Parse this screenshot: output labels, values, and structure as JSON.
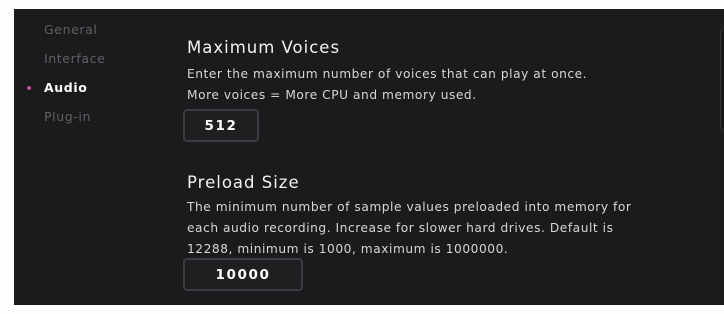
{
  "sidebar": {
    "items": [
      {
        "label": "General",
        "active": false
      },
      {
        "label": "Interface",
        "active": false
      },
      {
        "label": "Audio",
        "active": true
      },
      {
        "label": "Plug-in",
        "active": false
      }
    ]
  },
  "settings": {
    "maximum_voices": {
      "title": "Maximum Voices",
      "description": [
        "Enter the maximum number of voices that can play at once.",
        "More voices = More CPU and memory used."
      ],
      "value": "512"
    },
    "preload_size": {
      "title": "Preload Size",
      "description": [
        "The minimum number of sample values preloaded into memory for",
        "each audio recording. Increase for slower hard drives. Default is",
        "12288, minimum is 1000, maximum is 1000000."
      ],
      "value": "10000"
    }
  },
  "colors": {
    "background": "#1b1b1d",
    "active_indicator": "#c64f9b",
    "text_primary": "#ffffff",
    "text_muted": "#606064"
  }
}
